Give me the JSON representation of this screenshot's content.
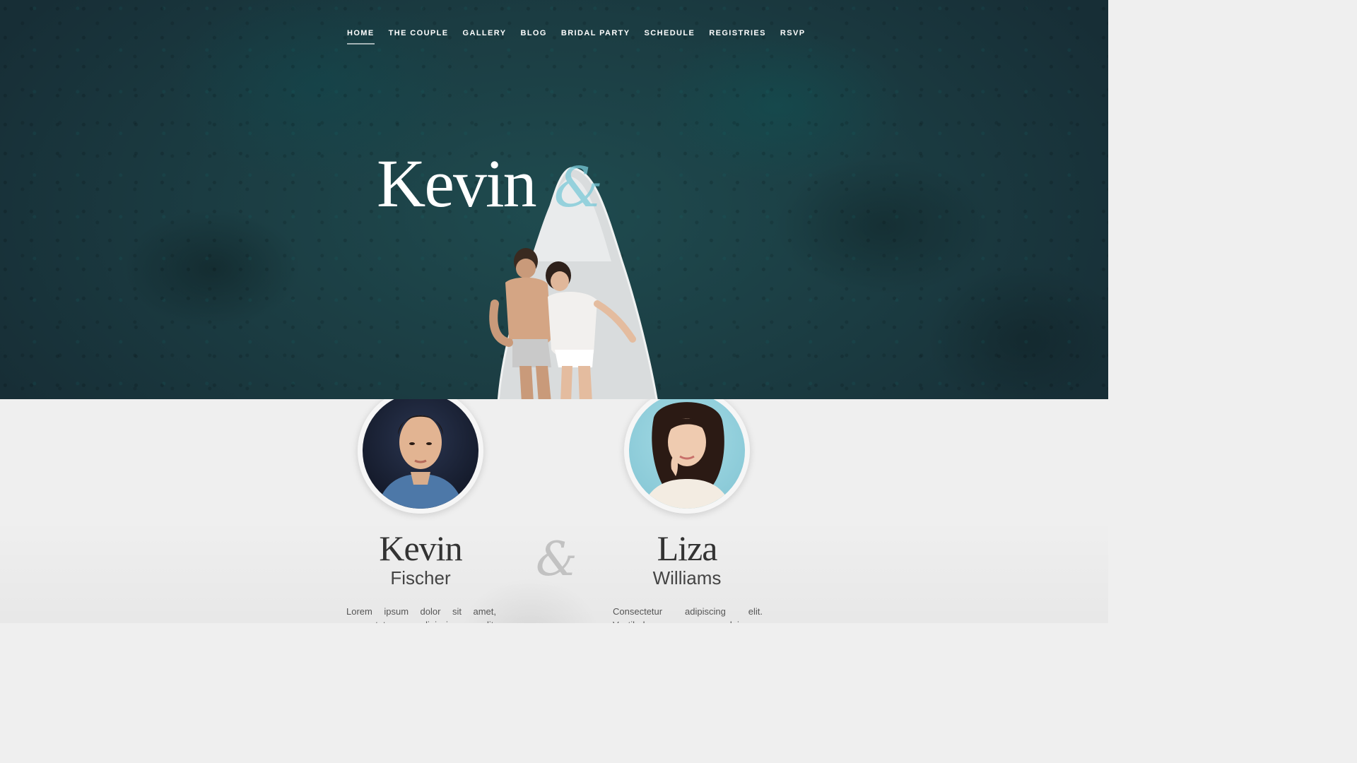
{
  "nav": {
    "items": [
      {
        "label": "HOME",
        "active": true
      },
      {
        "label": "THE COUPLE"
      },
      {
        "label": "GALLERY"
      },
      {
        "label": "BLOG"
      },
      {
        "label": "BRIDAL PARTY"
      },
      {
        "label": "SCHEDULE"
      },
      {
        "label": "REGISTRIES"
      },
      {
        "label": "RSVP"
      }
    ]
  },
  "hero": {
    "first_name": "Kevin",
    "ampersand": "&"
  },
  "couple": {
    "ampersand": "&",
    "groom": {
      "first_name": "Kevin",
      "last_name": "Fischer",
      "bio": "Lorem ipsum dolor sit amet, consectetur adipiscing elit."
    },
    "bride": {
      "first_name": "Liza",
      "last_name": "Williams",
      "bio": "Consectetur adipiscing elit. Vestibulum semper, dui a consectetur"
    }
  },
  "colors": {
    "hero_bg": "#1b3c42",
    "accent": "#78c8d7",
    "section_bg": "#efefef"
  }
}
